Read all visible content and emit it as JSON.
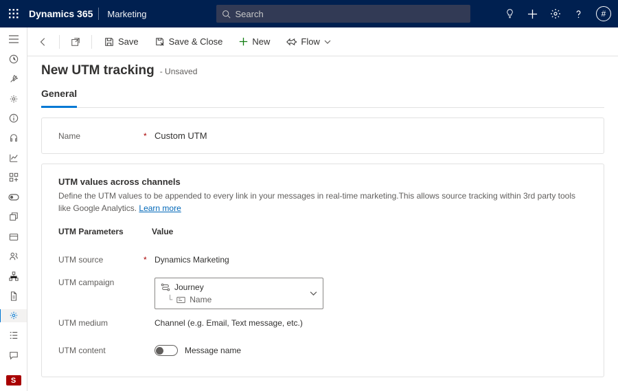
{
  "header": {
    "brand": "Dynamics 365",
    "module": "Marketing",
    "search_placeholder": "Search",
    "user_initial": "#"
  },
  "cmdbar": {
    "save": "Save",
    "save_close": "Save & Close",
    "new": "New",
    "flow": "Flow"
  },
  "page": {
    "title": "New UTM tracking",
    "status": "- Unsaved",
    "tab_general": "General"
  },
  "name_field": {
    "label": "Name",
    "value": "Custom UTM"
  },
  "utm_section": {
    "title": "UTM values across channels",
    "desc_a": "Define the UTM values to be appended to every link in your messages in real-time marketing.This allows source tracking within 3rd party tools like Google Analytics. ",
    "learn_more": "Learn more",
    "col_params": "UTM Parameters",
    "col_value": "Value",
    "source_label": "UTM source",
    "source_value": "Dynamics Marketing",
    "campaign_label": "UTM campaign",
    "campaign_option_main": "Journey",
    "campaign_option_sub": "Name",
    "medium_label": "UTM medium",
    "medium_value": "Channel (e.g. Email, Text message, etc.)",
    "content_label": "UTM content",
    "content_value": "Message name"
  },
  "sitemap_badge": "S"
}
